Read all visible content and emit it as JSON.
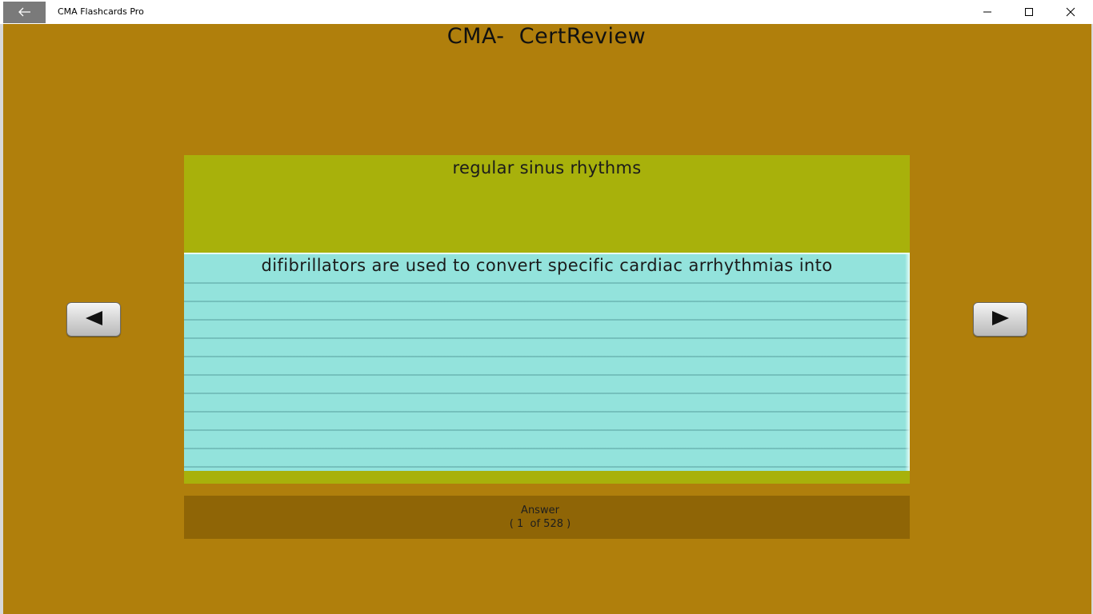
{
  "window": {
    "app_title": "CMA Flashcards Pro",
    "back_icon": "arrow-left-icon",
    "controls": [
      "minimize-icon",
      "maximize-icon",
      "close-icon"
    ]
  },
  "page": {
    "title": "CMA-  CertReview"
  },
  "card": {
    "answer_text": "regular sinus rhythms",
    "question_text": "difibrillators are used to convert specific cardiac arrhythmias into"
  },
  "navigation": {
    "prev_icon": "triangle-left-icon",
    "next_icon": "triangle-right-icon"
  },
  "answer_bar": {
    "label": "Answer",
    "counter": "( 1  of 528 )"
  },
  "colors": {
    "background": "#b07f0c",
    "card": "#a8b10b",
    "question_panel": "#93e3dc",
    "answer_bar": "#8f6506"
  }
}
